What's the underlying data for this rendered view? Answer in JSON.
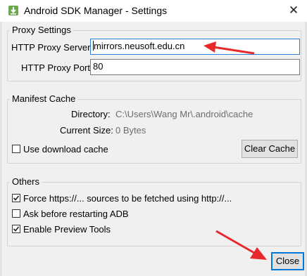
{
  "window": {
    "title": "Android SDK Manager - Settings",
    "close_glyph": "✕"
  },
  "proxy": {
    "legend": "Proxy Settings",
    "server_label": "HTTP Proxy Server",
    "server_value": "mirrors.neusoft.edu.cn",
    "port_label": "HTTP Proxy Port",
    "port_value": "80"
  },
  "manifest": {
    "legend": "Manifest Cache",
    "directory_label": "Directory:",
    "directory_value": "C:\\Users\\Wang Mr\\.android\\cache",
    "size_label": "Current Size:",
    "size_value": "0 Bytes",
    "use_cache_label": "Use download cache",
    "use_cache_checked": false,
    "clear_button": "Clear Cache"
  },
  "others": {
    "legend": "Others",
    "options": [
      {
        "label": "Force https://... sources to be fetched using http://...",
        "checked": true
      },
      {
        "label": "Ask before restarting ADB",
        "checked": false
      },
      {
        "label": "Enable Preview Tools",
        "checked": true
      }
    ]
  },
  "footer": {
    "close_button": "Close"
  },
  "colors": {
    "annotation_arrow": "#e8292b",
    "focus_border": "#2f7fd7"
  },
  "icons": {
    "app": "android-sdk-download-icon",
    "close": "close-icon",
    "check": "checkmark-icon"
  }
}
